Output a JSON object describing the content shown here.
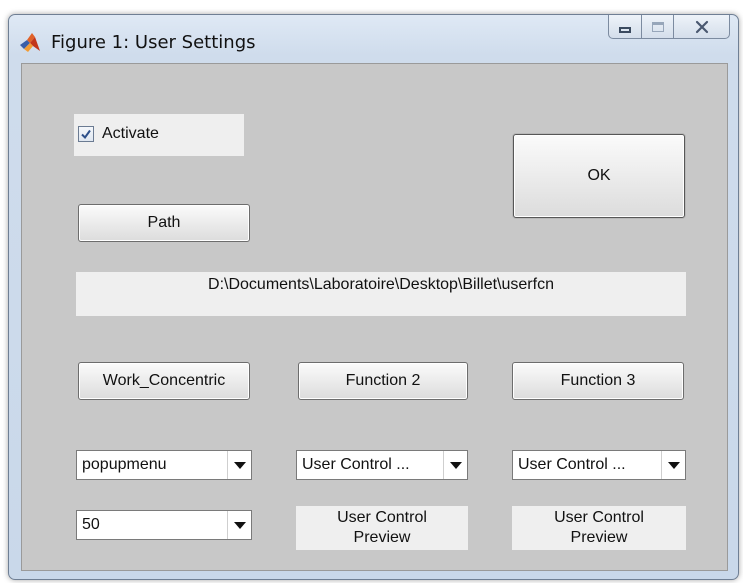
{
  "window": {
    "title": "Figure 1: User Settings"
  },
  "activate": {
    "label": "Activate",
    "checked": true
  },
  "buttons": {
    "ok": "OK",
    "path": "Path",
    "func1": "Work_Concentric",
    "func2": "Function 2",
    "func3": "Function 3"
  },
  "path_display": "D:\\Documents\\Laboratoire\\Desktop\\Billet\\userfcn",
  "popups": {
    "p1": "popupmenu",
    "p2": "User Control ...",
    "p3": "User Control ...",
    "p4": "50"
  },
  "previews": {
    "pv2_line1": "User Control",
    "pv2_line2": "Preview",
    "pv3_line1": "User Control",
    "pv3_line2": "Preview"
  },
  "icons": {
    "app": "matlab-icon",
    "minimize": "minimize-icon",
    "maximize": "maximize-icon",
    "close": "close-icon",
    "checkbox": "checkmark-icon",
    "dropdown": "chevron-down-icon"
  }
}
